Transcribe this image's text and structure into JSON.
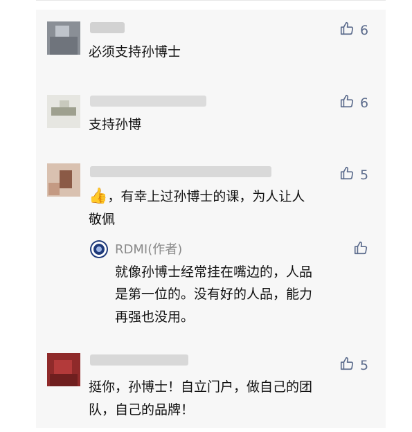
{
  "comments": [
    {
      "text_lines": [
        "必须支持孙博士"
      ],
      "likes": "6"
    },
    {
      "text_lines": [
        "支持孙博"
      ],
      "likes": "6"
    },
    {
      "emoji": "👍",
      "text_lines": [
        "，有幸上过孙博士的课，为人让人",
        "敬佩"
      ],
      "likes": "5"
    },
    {
      "text_lines": [
        "挺你，孙博士！自立门户，做自己的团",
        "队，自己的品牌！"
      ],
      "likes": "5"
    }
  ],
  "reply": {
    "author": "RDMI(作者)",
    "text_lines": [
      "就像孙博士经常挂在嘴边的，人品",
      "是第一位的。没有好的人品，能力",
      "再强也没用。"
    ]
  },
  "icons": {
    "like": "thumbs-up-icon",
    "author_logo": "rdmi-logo-icon",
    "emoji": "thumbs-up-emoji"
  },
  "colors": {
    "like": "#5b6b8c",
    "text": "#111111",
    "meta": "#8a8a8a",
    "panel": "#f7f7f7"
  }
}
